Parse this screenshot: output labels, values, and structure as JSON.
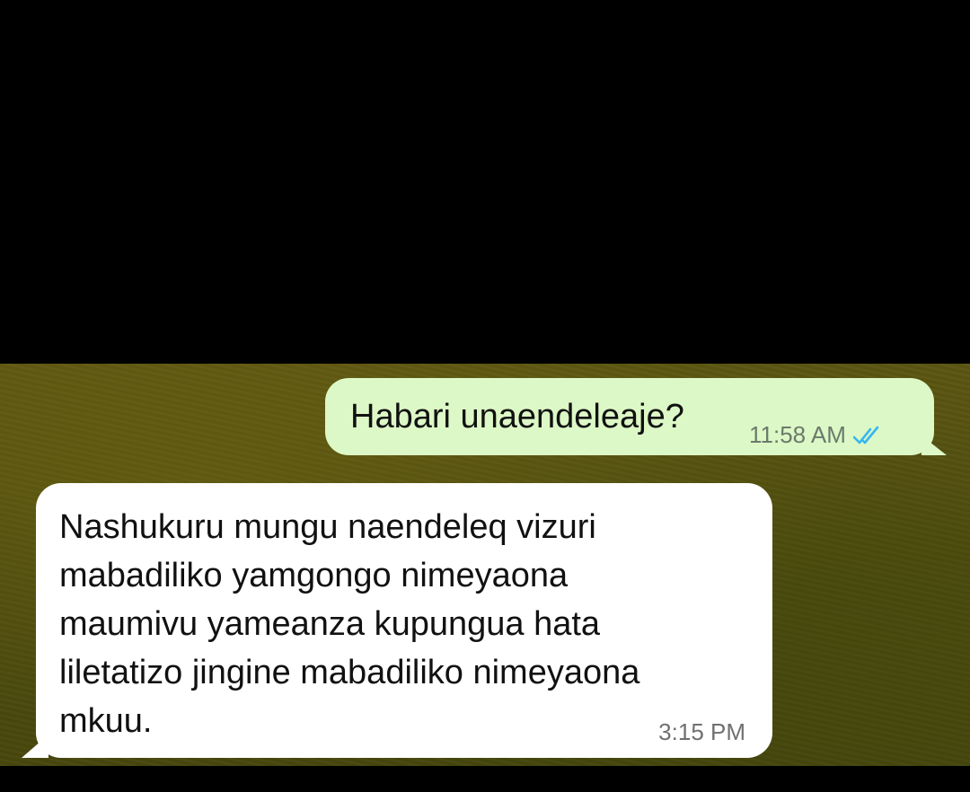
{
  "chat": {
    "messages": [
      {
        "direction": "outgoing",
        "lines": [
          "Habari unaendeleaje?"
        ],
        "time": "11:58 AM",
        "status_icon": "double-check-icon",
        "status_color": "#34b7f1"
      },
      {
        "direction": "incoming",
        "lines": [
          "Nashukuru mungu naendeleq vizuri",
          "mabadiliko yamgongo nimeyaona",
          "maumivu yameanza kupungua hata",
          "liletatizo jingine mabadiliko nimeyaona",
          "mkuu."
        ],
        "time": "3:15 PM"
      }
    ]
  },
  "colors": {
    "outgoing_bubble": "#dcf8c6",
    "incoming_bubble": "#ffffff",
    "wallpaper": "#524f10",
    "letterbox": "#000000"
  }
}
